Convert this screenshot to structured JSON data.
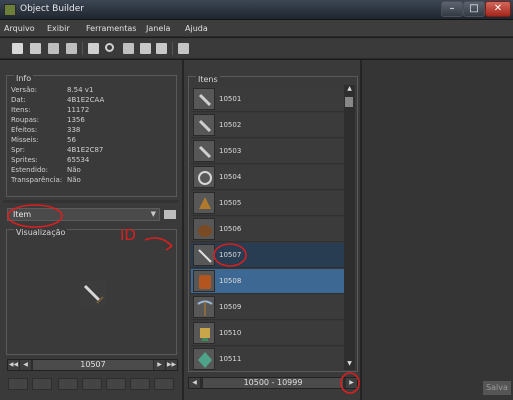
{
  "window": {
    "title": "Object Builder",
    "min": "–",
    "max": "□",
    "close": "✕"
  },
  "menu": [
    "Arquivo",
    "Exibir",
    "Ferramentas",
    "Janela",
    "Ajuda"
  ],
  "info": {
    "title": "Info",
    "rows": [
      {
        "key": "Versão:",
        "value": "8.54 v1"
      },
      {
        "key": "Dat:",
        "value": "4B1E2CAA"
      },
      {
        "key": "Itens:",
        "value": "11172"
      },
      {
        "key": "Roupas:",
        "value": "1356"
      },
      {
        "key": "Efeitos:",
        "value": "338"
      },
      {
        "key": "Misseis:",
        "value": "56"
      },
      {
        "key": "Spr:",
        "value": "4B1E2C87"
      },
      {
        "key": "Sprites:",
        "value": "65534"
      },
      {
        "key": "Estendido:",
        "value": "Não"
      },
      {
        "key": "Transparência:",
        "value": "Não"
      }
    ]
  },
  "category_select": {
    "value": "Item"
  },
  "preview": {
    "title": "Visualização"
  },
  "preview_pager": {
    "value": "10507"
  },
  "items": {
    "title": "Itens",
    "rows": [
      {
        "id": "10501",
        "icon": "chain-icon"
      },
      {
        "id": "10502",
        "icon": "chain-icon"
      },
      {
        "id": "10503",
        "icon": "chain-icon"
      },
      {
        "id": "10504",
        "icon": "wreath-icon"
      },
      {
        "id": "10505",
        "icon": "shell-icon"
      },
      {
        "id": "10506",
        "icon": "bag-icon"
      },
      {
        "id": "10507",
        "icon": "sword-icon"
      },
      {
        "id": "10508",
        "icon": "backpack-icon"
      },
      {
        "id": "10509",
        "icon": "pickaxe-icon"
      },
      {
        "id": "10510",
        "icon": "trophy-icon"
      },
      {
        "id": "10511",
        "icon": "leaf-icon"
      }
    ],
    "range": "10500 - 10999"
  },
  "annotation": {
    "text": "ID"
  },
  "save_label": "Salva"
}
